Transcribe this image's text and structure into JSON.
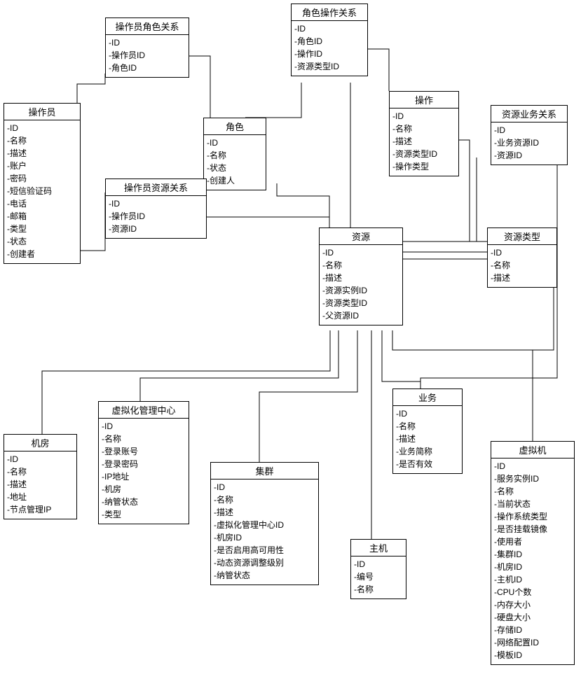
{
  "entities": {
    "operator": {
      "title": "操作员",
      "attrs": [
        "-ID",
        "-名称",
        "-描述",
        "-账户",
        "-密码",
        "-短信验证码",
        "-电话",
        "-邮箱",
        "-类型",
        "-状态",
        "-创建者"
      ]
    },
    "opRoleRel": {
      "title": "操作员角色关系",
      "attrs": [
        "-ID",
        "-操作员ID",
        "-角色ID"
      ]
    },
    "roleOpRel": {
      "title": "角色操作关系",
      "attrs": [
        "-ID",
        "-角色ID",
        "-操作ID",
        "-资源类型ID"
      ]
    },
    "role": {
      "title": "角色",
      "attrs": [
        "-ID",
        "-名称",
        "-状态",
        "-创建人"
      ]
    },
    "operation": {
      "title": "操作",
      "attrs": [
        "-ID",
        "-名称",
        "-描述",
        "-资源类型ID",
        "-操作类型"
      ]
    },
    "resBizRel": {
      "title": "资源业务关系",
      "attrs": [
        "-ID",
        "-业务资源ID",
        "-资源ID"
      ]
    },
    "opResRel": {
      "title": "操作员资源关系",
      "attrs": [
        "-ID",
        "-操作员ID",
        "-资源ID"
      ]
    },
    "resource": {
      "title": "资源",
      "attrs": [
        "-ID",
        "-名称",
        "-描述",
        "-资源实例ID",
        "-资源类型ID",
        "-父资源ID"
      ]
    },
    "resType": {
      "title": "资源类型",
      "attrs": [
        "-ID",
        "-名称",
        "-描述"
      ]
    },
    "room": {
      "title": "机房",
      "attrs": [
        "-ID",
        "-名称",
        "-描述",
        "-地址",
        "-节点管理IP"
      ]
    },
    "vCenter": {
      "title": "虚拟化管理中心",
      "attrs": [
        "-ID",
        "-名称",
        "-登录账号",
        "-登录密码",
        "-IP地址",
        "-机房",
        "-纳管状态",
        "-类型"
      ]
    },
    "cluster": {
      "title": "集群",
      "attrs": [
        "-ID",
        "-名称",
        "-描述",
        "-虚拟化管理中心ID",
        "-机房ID",
        "-是否启用高可用性",
        "-动态资源调整级别",
        "-纳管状态"
      ]
    },
    "biz": {
      "title": "业务",
      "attrs": [
        "-ID",
        "-名称",
        "-描述",
        "-业务简称",
        "-是否有效"
      ]
    },
    "host": {
      "title": "主机",
      "attrs": [
        "-ID",
        "-编号",
        "-名称"
      ]
    },
    "vm": {
      "title": "虚拟机",
      "attrs": [
        "-ID",
        "-服务实例ID",
        "-名称",
        "-当前状态",
        "-操作系统类型",
        "-是否挂载镜像",
        "-使用者",
        "-集群ID",
        "-机房ID",
        "-主机ID",
        "-CPU个数",
        "-内存大小",
        "-硬盘大小",
        "-存储ID",
        "-网络配置ID",
        "-模板ID"
      ]
    }
  }
}
